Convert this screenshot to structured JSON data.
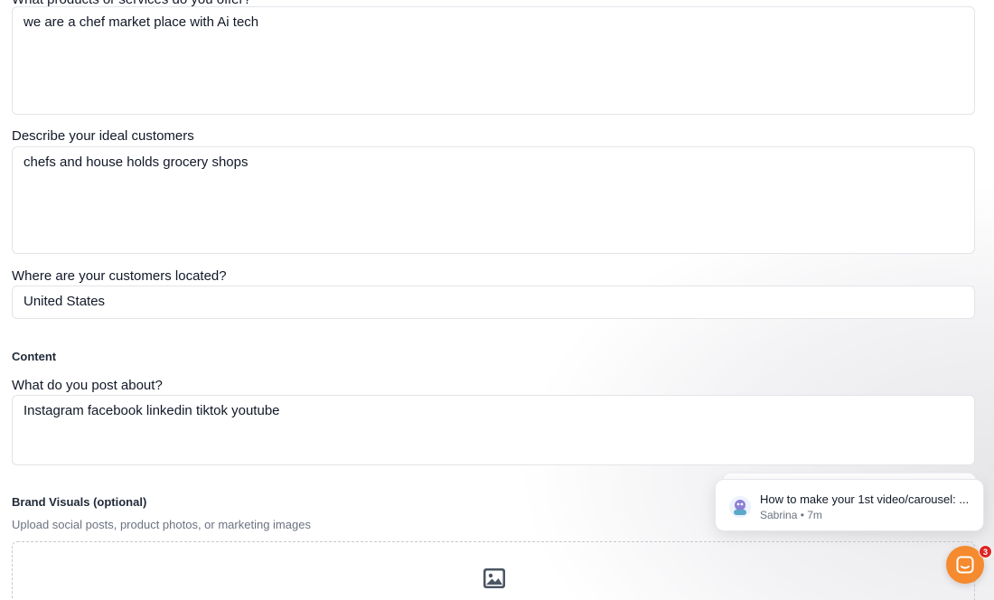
{
  "form": {
    "products_label": "What products or services do you offer?",
    "products_value": "we are a chef market place with Ai tech",
    "customers_label": "Describe your ideal customers",
    "customers_value": "chefs and house holds grocery shops",
    "location_label": "Where are your customers located?",
    "location_value": "United States",
    "content_section": "Content",
    "post_label": "What do you post about?",
    "post_value": "Instagram facebook linkedin tiktok youtube",
    "brand_section": "Brand Visuals (optional)",
    "brand_help": "Upload social posts, product photos, or marketing images"
  },
  "chat": {
    "toast_title": "How to make your 1st video/carousel: ...",
    "toast_meta": "Sabrina • 7m",
    "badge_count": "3",
    "launcher_color": "#f58a2e"
  },
  "icons": {
    "upload": "image-icon",
    "chat": "chat-icon",
    "avatar": "agent-avatar-icon"
  }
}
